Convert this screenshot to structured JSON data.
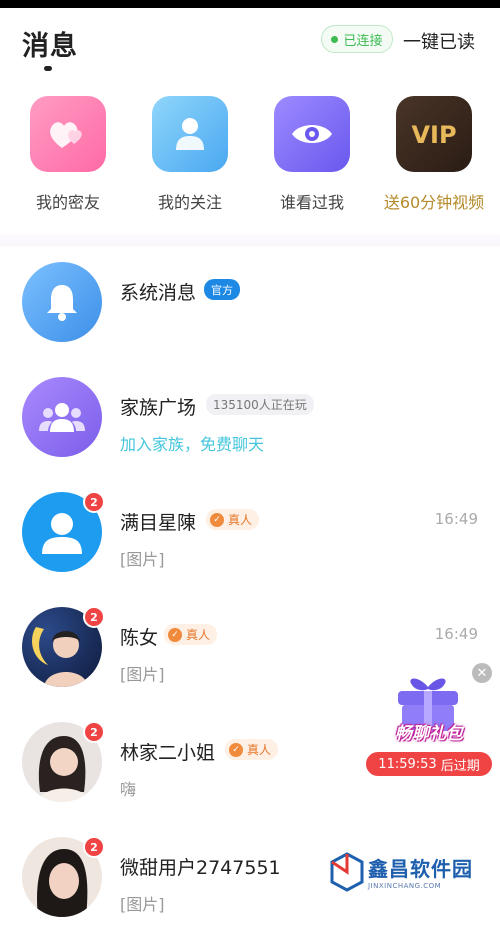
{
  "header": {
    "title": "消息",
    "connection_status": "已连接",
    "mark_all_read": "一键已读"
  },
  "shortcuts": [
    {
      "label": "我的密友",
      "icon": "hearts-icon",
      "color": "#ff7fb0"
    },
    {
      "label": "我的关注",
      "icon": "person-icon",
      "color": "#5ab8f5"
    },
    {
      "label": "谁看过我",
      "icon": "eye-icon",
      "color": "#7a6cf5"
    },
    {
      "label": "送60分钟视频",
      "icon": "vip-icon",
      "color": "#3a2a20"
    }
  ],
  "conversations": [
    {
      "name": "系统消息",
      "tag": "官方",
      "subtitle": "",
      "time": "",
      "badge": ""
    },
    {
      "name": "家族广场",
      "tag": "135100人正在玩",
      "subtitle": "加入家族，免费聊天",
      "time": "",
      "badge": ""
    },
    {
      "name": "满目星陳",
      "tag": "真人",
      "subtitle": "[图片]",
      "time": "16:49",
      "badge": "2"
    },
    {
      "name": "陈女",
      "tag": "真人",
      "subtitle": "[图片]",
      "time": "16:49",
      "badge": "2"
    },
    {
      "name": "林家二小姐",
      "tag": "真人",
      "subtitle": "嗨",
      "time": "",
      "badge": "2"
    },
    {
      "name": "微甜用户2747551",
      "tag": "",
      "subtitle": "[图片]",
      "time": "",
      "badge": "2"
    }
  ],
  "gift": {
    "label": "畅聊礼包",
    "countdown": "11:59:53",
    "expire_text": "后过期"
  },
  "watermark": {
    "main": "鑫昌软件园",
    "sub": "JINXINCHANG.COM"
  },
  "colors": {
    "accent_green": "#3dbb52",
    "badge_red": "#f04343",
    "official_blue": "#1e88e5",
    "real_orange": "#e7762a",
    "vip_gold": "#b58a2a"
  }
}
